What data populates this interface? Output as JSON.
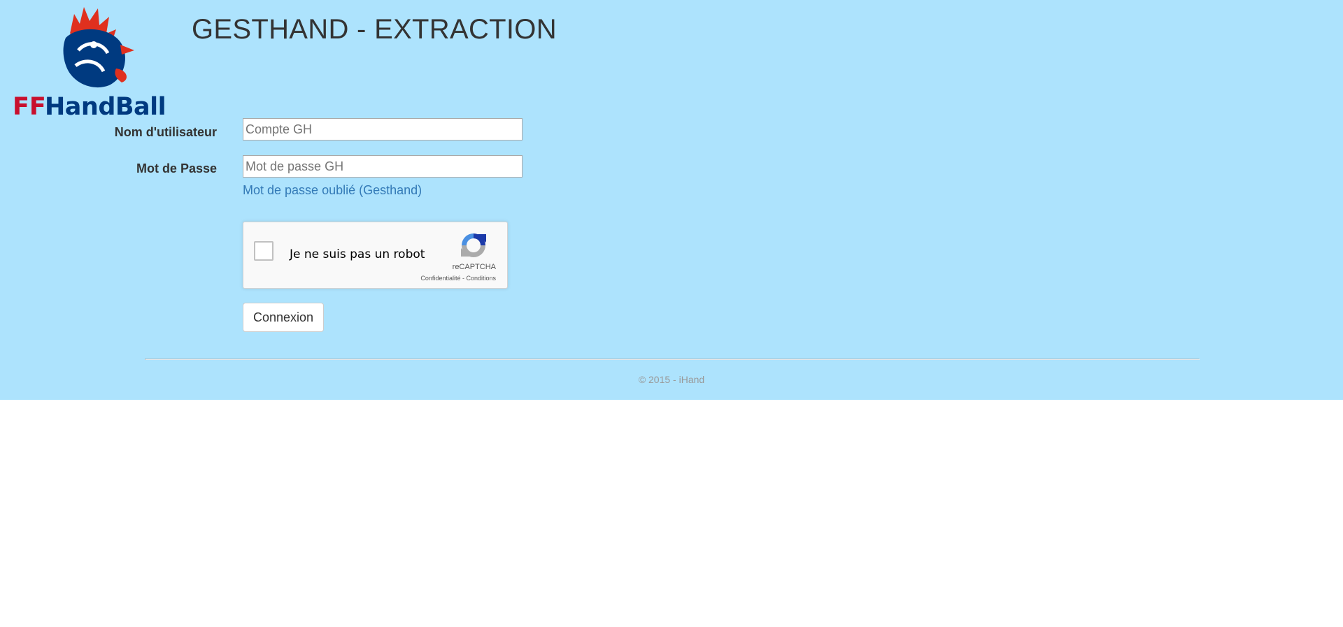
{
  "logo": {
    "text_ff": "FF",
    "text_rest": "HandBall"
  },
  "header": {
    "title": "GESTHAND - EXTRACTION"
  },
  "form": {
    "username_label": "Nom d'utilisateur",
    "username_placeholder": "Compte GH",
    "username_value": "",
    "password_label": "Mot de Passe",
    "password_placeholder": "Mot de passe GH",
    "password_value": "",
    "forgot_link": "Mot de passe oublié (Gesthand)",
    "login_button": "Connexion"
  },
  "recaptcha": {
    "label": "Je ne suis pas un robot",
    "brand": "reCAPTCHA",
    "privacy": "Confidentialité",
    "separator": " - ",
    "terms": "Conditions",
    "checked": false
  },
  "footer": {
    "copyright": "© 2015 - iHand"
  },
  "colors": {
    "banner_bg": "#ade3fd",
    "link": "#337ab7",
    "logo_red": "#c8102e",
    "logo_blue": "#003a80"
  }
}
